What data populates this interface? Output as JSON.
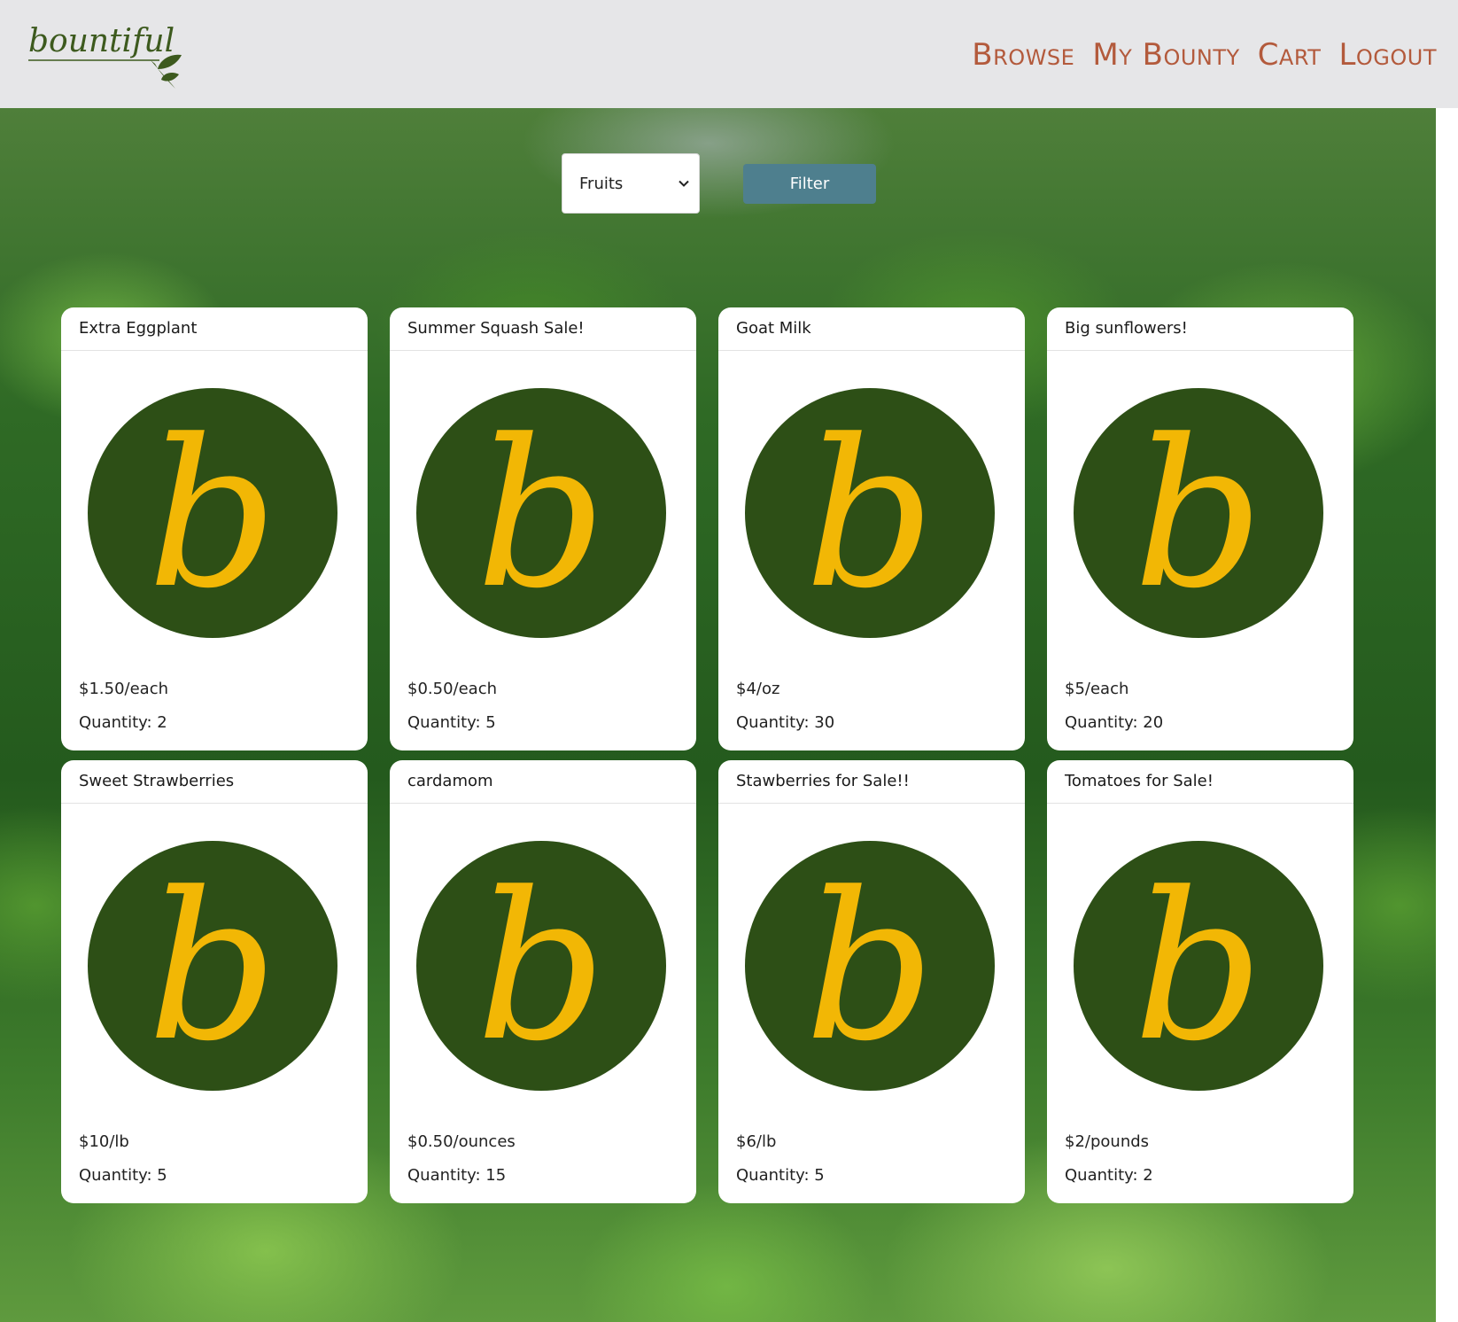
{
  "header": {
    "logo_text": "bountiful",
    "nav": [
      "Browse",
      "My Bounty",
      "Cart",
      "Logout"
    ]
  },
  "filter": {
    "selected_category": "Fruits",
    "button_label": "Filter"
  },
  "listings": [
    {
      "title": "Extra Eggplant",
      "price": "$1.50/each",
      "quantity": "Quantity: 2"
    },
    {
      "title": "Summer Squash Sale!",
      "price": "$0.50/each",
      "quantity": "Quantity: 5"
    },
    {
      "title": "Goat Milk",
      "price": "$4/oz",
      "quantity": "Quantity: 30"
    },
    {
      "title": "Big sunflowers!",
      "price": "$5/each",
      "quantity": "Quantity: 20"
    },
    {
      "title": "Sweet Strawberries",
      "price": "$10/lb",
      "quantity": "Quantity: 5"
    },
    {
      "title": "cardamom",
      "price": "$0.50/ounces",
      "quantity": "Quantity: 15"
    },
    {
      "title": "Stawberries for Sale!!",
      "price": "$6/lb",
      "quantity": "Quantity: 5"
    },
    {
      "title": "Tomatoes for Sale!",
      "price": "$2/pounds",
      "quantity": "Quantity: 2"
    }
  ],
  "colors": {
    "nav_link": "#b35a3c",
    "filter_button": "#4e7f8e",
    "logo_circle": "#2d4f16",
    "logo_letter": "#f2b705"
  },
  "icons": {
    "card_image": "bountiful-b-logo-icon",
    "select_arrow": "chevron-down-icon"
  }
}
